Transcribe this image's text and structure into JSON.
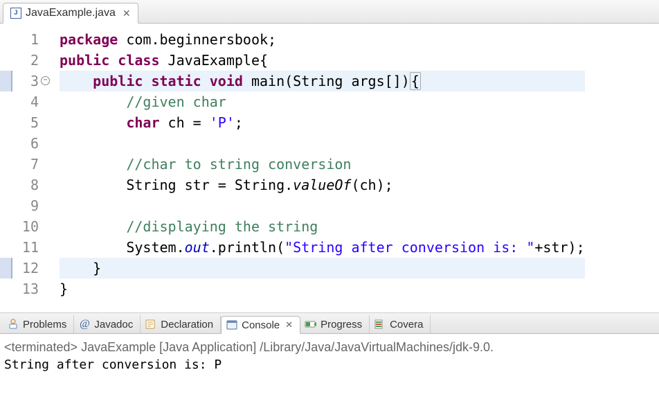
{
  "editor": {
    "tab": {
      "filename": "JavaExample.java",
      "icon_letter": "J"
    },
    "lines": [
      1,
      2,
      3,
      4,
      5,
      6,
      7,
      8,
      9,
      10,
      11,
      12,
      13
    ],
    "markers": [
      false,
      false,
      true,
      false,
      false,
      false,
      false,
      false,
      false,
      false,
      false,
      true,
      false
    ],
    "fold_at_line": 3,
    "highlight_lines": [
      3,
      12
    ],
    "tokens": {
      "l1_kw1": "package",
      "l1_pkg": " com.beginnersbook;",
      "l2_kw1": "public",
      "l2_kw2": "class",
      "l2_name": " JavaExample{",
      "l3_kw1": "public",
      "l3_kw2": "static",
      "l3_kw3": "void",
      "l3_name": " main(String args[])",
      "l3_brace": "{",
      "l4_cmt": "//given char",
      "l5_kw": "char",
      "l5_txt1": " ch = ",
      "l5_str": "'P'",
      "l5_semi": ";",
      "l7_cmt": "//char to string conversion",
      "l8_txt1": "String str = String.",
      "l8_mtd": "valueOf",
      "l8_txt2": "(ch);",
      "l10_cmt": "//displaying the string",
      "l11_txt1": "System.",
      "l11_fld": "out",
      "l11_txt2": ".println(",
      "l11_str": "\"String after conversion is: \"",
      "l11_txt3": "+str);",
      "l12_txt": "}",
      "l13_txt": "}"
    }
  },
  "views": {
    "problems": "Problems",
    "javadoc": "Javadoc",
    "declaration": "Declaration",
    "console": "Console",
    "progress": "Progress",
    "coverage": "Covera"
  },
  "console": {
    "process": "<terminated> JavaExample [Java Application] /Library/Java/JavaVirtualMachines/jdk-9.0.",
    "output": "String after conversion is: P"
  }
}
